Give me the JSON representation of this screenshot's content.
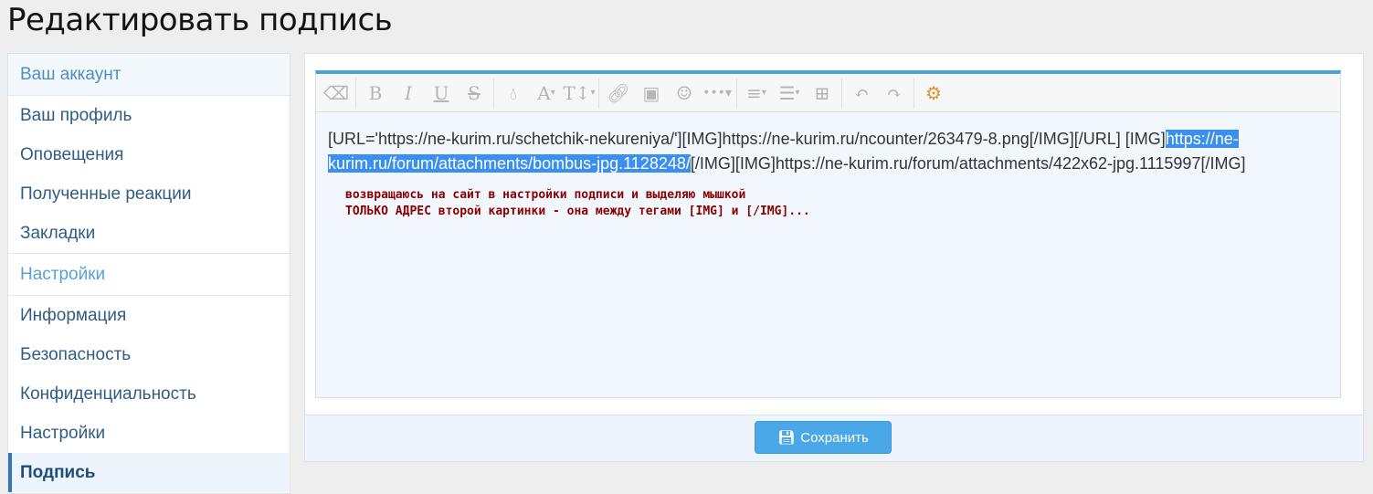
{
  "page_title": "Редактировать подпись",
  "sidebar": {
    "section1": "Ваш аккаунт",
    "items1": [
      "Ваш профиль",
      "Оповещения",
      "Полученные реакции",
      "Закладки"
    ],
    "section2": "Настройки",
    "items2": [
      "Информация",
      "Безопасность",
      "Конфиденциальность",
      "Настройки",
      "Подпись"
    ]
  },
  "editor": {
    "text_before": "[URL='https://ne-kurim.ru/schetchik-nekureniya/'][IMG]https://ne-kurim.ru/ncounter/263479-8.png[/IMG][/URL] [IMG]",
    "selected": "https://ne-kurim.ru/forum/attachments/bombus-jpg.1128248/",
    "text_after": "[/IMG][IMG]https://ne-kurim.ru/forum/attachments/422x62-jpg.1115997[/IMG]",
    "note_line1": "возвращаюсь на сайт в настройки подписи и выделяю мышкой",
    "note_line2": "ТОЛЬКО АДРЕС второй картинки - она между тегами [IMG] и [/IMG]..."
  },
  "save_label": "Сохранить",
  "colors": {
    "accent": "#4aa8e8",
    "selection": "#3b8ff0",
    "note": "#8b0000"
  }
}
